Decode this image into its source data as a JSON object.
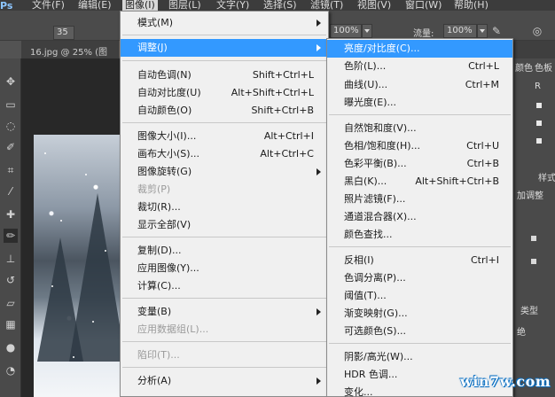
{
  "menubar": {
    "items": [
      "文件(F)",
      "编辑(E)",
      "图像(I)",
      "图层(L)",
      "文字(Y)",
      "选择(S)",
      "滤镜(T)",
      "视图(V)",
      "窗口(W)",
      "帮助(H)"
    ],
    "active_index": 2
  },
  "options_bar": {
    "brush_size": "35",
    "opacity": "100%",
    "flow_label": "流量:",
    "flow": "100%",
    "app_logo": "Ps"
  },
  "document_tab": "16.jpg @ 25% (图",
  "right_panel": {
    "tabs": [
      "颜色",
      "色板"
    ],
    "channel_label": "R",
    "adjust_label": "加调整",
    "style_label": "样式",
    "type_label": "类型",
    "mode_label": "绝"
  },
  "image_menu": {
    "items": [
      {
        "label": "模式(M)",
        "shortcut": "",
        "submenu": true,
        "disabled": false,
        "highlighted": false
      },
      {
        "label": "调整(J)",
        "shortcut": "",
        "submenu": true,
        "disabled": false,
        "highlighted": true
      },
      {
        "label": "自动色调(N)",
        "shortcut": "Shift+Ctrl+L",
        "submenu": false,
        "disabled": false,
        "highlighted": false
      },
      {
        "label": "自动对比度(U)",
        "shortcut": "Alt+Shift+Ctrl+L",
        "submenu": false,
        "disabled": false,
        "highlighted": false
      },
      {
        "label": "自动颜色(O)",
        "shortcut": "Shift+Ctrl+B",
        "submenu": false,
        "disabled": false,
        "highlighted": false
      },
      {
        "label": "图像大小(I)...",
        "shortcut": "Alt+Ctrl+I",
        "submenu": false,
        "disabled": false,
        "highlighted": false
      },
      {
        "label": "画布大小(S)...",
        "shortcut": "Alt+Ctrl+C",
        "submenu": false,
        "disabled": false,
        "highlighted": false
      },
      {
        "label": "图像旋转(G)",
        "shortcut": "",
        "submenu": true,
        "disabled": false,
        "highlighted": false
      },
      {
        "label": "裁剪(P)",
        "shortcut": "",
        "submenu": false,
        "disabled": true,
        "highlighted": false
      },
      {
        "label": "裁切(R)...",
        "shortcut": "",
        "submenu": false,
        "disabled": false,
        "highlighted": false
      },
      {
        "label": "显示全部(V)",
        "shortcut": "",
        "submenu": false,
        "disabled": false,
        "highlighted": false
      },
      {
        "label": "复制(D)...",
        "shortcut": "",
        "submenu": false,
        "disabled": false,
        "highlighted": false
      },
      {
        "label": "应用图像(Y)...",
        "shortcut": "",
        "submenu": false,
        "disabled": false,
        "highlighted": false
      },
      {
        "label": "计算(C)...",
        "shortcut": "",
        "submenu": false,
        "disabled": false,
        "highlighted": false
      },
      {
        "label": "变量(B)",
        "shortcut": "",
        "submenu": true,
        "disabled": false,
        "highlighted": false
      },
      {
        "label": "应用数据组(L)...",
        "shortcut": "",
        "submenu": false,
        "disabled": true,
        "highlighted": false
      },
      {
        "label": "陷印(T)...",
        "shortcut": "",
        "submenu": false,
        "disabled": true,
        "highlighted": false
      },
      {
        "label": "分析(A)",
        "shortcut": "",
        "submenu": true,
        "disabled": false,
        "highlighted": false
      }
    ]
  },
  "adjust_menu": {
    "items": [
      {
        "label": "亮度/对比度(C)...",
        "shortcut": "",
        "highlighted": true
      },
      {
        "label": "色阶(L)...",
        "shortcut": "Ctrl+L",
        "highlighted": false
      },
      {
        "label": "曲线(U)...",
        "shortcut": "Ctrl+M",
        "highlighted": false
      },
      {
        "label": "曝光度(E)...",
        "shortcut": "",
        "highlighted": false
      },
      {
        "label": "自然饱和度(V)...",
        "shortcut": "",
        "highlighted": false
      },
      {
        "label": "色相/饱和度(H)...",
        "shortcut": "Ctrl+U",
        "highlighted": false
      },
      {
        "label": "色彩平衡(B)...",
        "shortcut": "Ctrl+B",
        "highlighted": false
      },
      {
        "label": "黑白(K)...",
        "shortcut": "Alt+Shift+Ctrl+B",
        "highlighted": false
      },
      {
        "label": "照片滤镜(F)...",
        "shortcut": "",
        "highlighted": false
      },
      {
        "label": "通道混合器(X)...",
        "shortcut": "",
        "highlighted": false
      },
      {
        "label": "颜色查找...",
        "shortcut": "",
        "highlighted": false
      },
      {
        "label": "反相(I)",
        "shortcut": "Ctrl+I",
        "highlighted": false
      },
      {
        "label": "色调分离(P)...",
        "shortcut": "",
        "highlighted": false
      },
      {
        "label": "阈值(T)...",
        "shortcut": "",
        "highlighted": false
      },
      {
        "label": "渐变映射(G)...",
        "shortcut": "",
        "highlighted": false
      },
      {
        "label": "可选颜色(S)...",
        "shortcut": "",
        "highlighted": false
      },
      {
        "label": "阴影/高光(W)...",
        "shortcut": "",
        "highlighted": false
      },
      {
        "label": "HDR 色调...",
        "shortcut": "",
        "highlighted": false
      },
      {
        "label": "变化...",
        "shortcut": "",
        "highlighted": false
      }
    ]
  },
  "watermark": "win7w.com",
  "colors": {
    "highlight": "#3399ff",
    "menu_bg": "#f0f0f0",
    "disabled_text": "#9a9a9a",
    "chrome_bg": "#535353"
  }
}
